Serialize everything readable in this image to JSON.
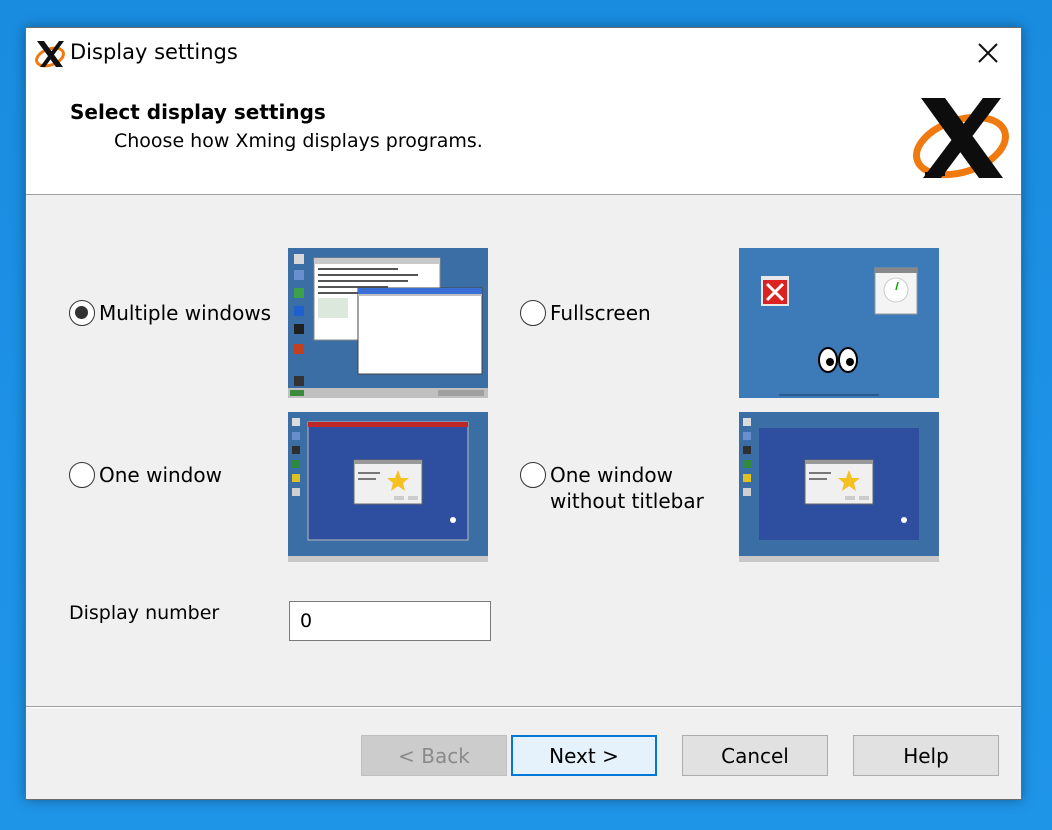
{
  "window": {
    "title": "Display settings",
    "close_icon": "close-icon"
  },
  "header": {
    "title": "Select display settings",
    "subtitle": "Choose how Xming displays programs.",
    "logo_icon": "xming-logo-icon"
  },
  "options": [
    {
      "label": "Multiple windows",
      "selected": true
    },
    {
      "label": "Fullscreen",
      "selected": false
    },
    {
      "label": "One window",
      "selected": false
    },
    {
      "label": "One window\nwithout titlebar",
      "selected": false
    }
  ],
  "display_number": {
    "label": "Display number",
    "value": "0"
  },
  "buttons": {
    "back": "< Back",
    "next": "Next >",
    "cancel": "Cancel",
    "help": "Help"
  },
  "colors": {
    "desktop": "#1f8fe0",
    "dialog_bg": "#f0f0f0",
    "accent": "#0078d7",
    "logo_orange": "#f07a10"
  }
}
